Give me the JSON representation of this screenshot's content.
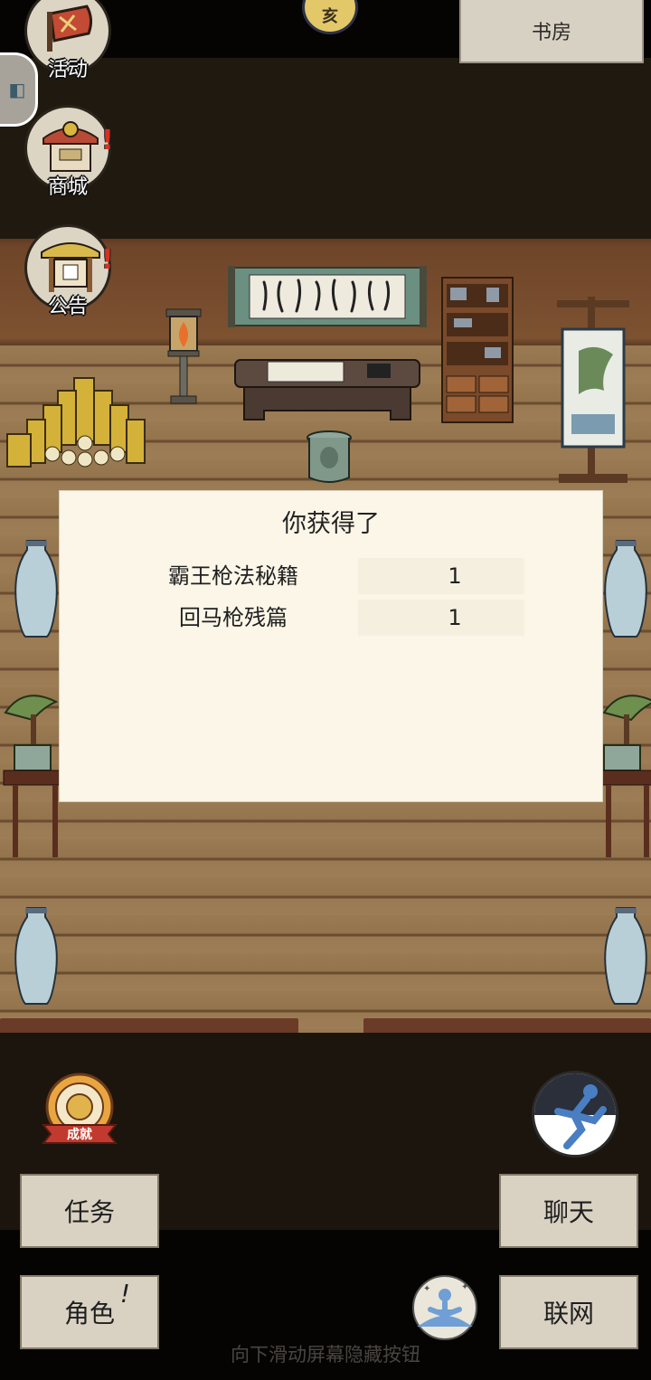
{
  "location": {
    "label": "书房"
  },
  "time_badge": {
    "label": "亥"
  },
  "side_menu": [
    {
      "label": "活动",
      "icon": "banner-flag-icon"
    },
    {
      "label": "商城",
      "icon": "shop-stall-icon"
    },
    {
      "label": "公告",
      "icon": "notice-board-icon"
    }
  ],
  "dialog": {
    "title": "你获得了",
    "rewards": [
      {
        "name": "霸王枪法秘籍",
        "qty": "1"
      },
      {
        "name": "回马枪残篇",
        "qty": "1"
      }
    ]
  },
  "achievement": {
    "label": "成就"
  },
  "buttons": {
    "tasks": "任务",
    "role": "角色",
    "role_alert": "!",
    "chat": "聊天",
    "network": "联网"
  },
  "hint": "向下滑动屏幕隐藏按钮",
  "colors": {
    "dialog_bg": "#fbf6e8",
    "button_bg": "#d9d2c3",
    "alert_red": "#d83020",
    "floor_wood": "#9a7a52"
  }
}
